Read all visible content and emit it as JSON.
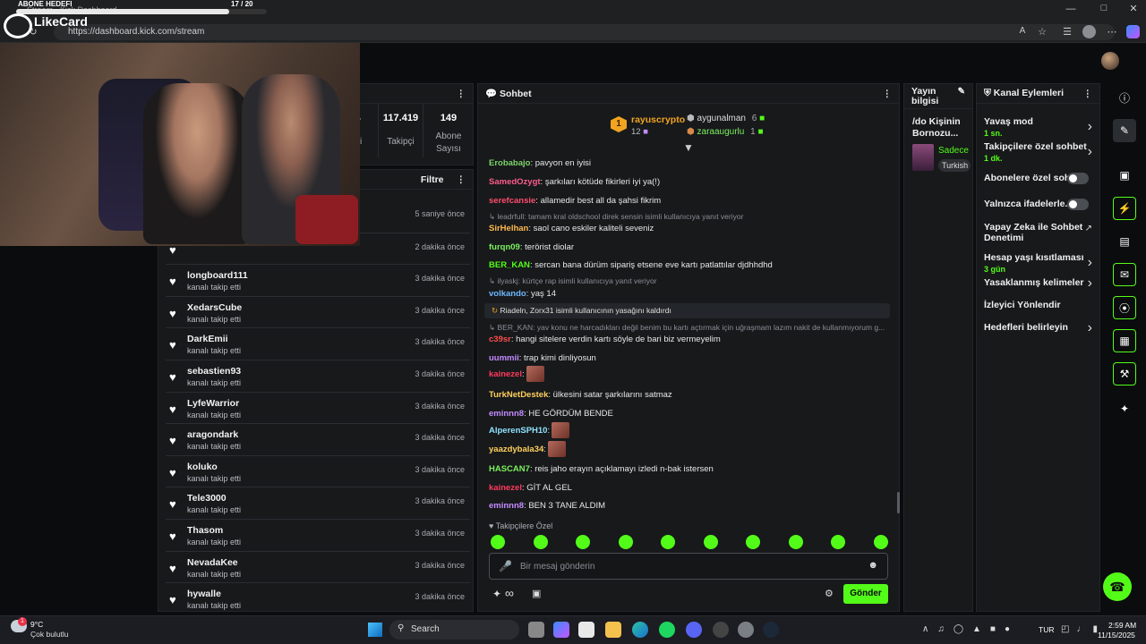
{
  "browser": {
    "overlay_goal_label": "ABONE HEDEFI",
    "overlay_goal_count": "17 / 20",
    "overlay_goal_fraction": 0.85,
    "overlay_brand": "LikeCard",
    "tab_title": "Stream - Kick Dashboard",
    "url": "https://dashboard.kick.com/stream"
  },
  "stats": {
    "partial_value": "4",
    "partial_label": "ici",
    "followers_value": "117.419",
    "followers_label": "Takipçi",
    "subs_value": "149",
    "subs_label_1": "Abone",
    "subs_label_2": "Sayısı"
  },
  "activity": {
    "filter_label": "Filtre",
    "rows": [
      {
        "name": "",
        "sub": "",
        "time": "5 saniye önce"
      },
      {
        "name": "",
        "sub": "",
        "time": "2 dakika önce"
      },
      {
        "name": "longboard111",
        "sub": "kanalı takip etti",
        "time": "3 dakika önce"
      },
      {
        "name": "XedarsCube",
        "sub": "kanalı takip etti",
        "time": "3 dakika önce"
      },
      {
        "name": "DarkEmii",
        "sub": "kanalı takip etti",
        "time": "3 dakika önce"
      },
      {
        "name": "sebastien93",
        "sub": "kanalı takip etti",
        "time": "3 dakika önce"
      },
      {
        "name": "LyfeWarrior",
        "sub": "kanalı takip etti",
        "time": "3 dakika önce"
      },
      {
        "name": "aragondark",
        "sub": "kanalı takip etti",
        "time": "3 dakika önce"
      },
      {
        "name": "koluko",
        "sub": "kanalı takip etti",
        "time": "3 dakika önce"
      },
      {
        "name": "Tele3000",
        "sub": "kanalı takip etti",
        "time": "3 dakika önce"
      },
      {
        "name": "Thasom",
        "sub": "kanalı takip etti",
        "time": "3 dakika önce"
      },
      {
        "name": "NevadaKee",
        "sub": "kanalı takip etti",
        "time": "3 dakika önce"
      },
      {
        "name": "hywalle",
        "sub": "kanalı takip etti",
        "time": "3 dakika önce"
      }
    ]
  },
  "chat": {
    "title": "Sohbet",
    "leader_rank": "1",
    "leader_name": "rayuscrypto",
    "leader_count": "12",
    "top2_name": "aygunalman",
    "top2_count": "6",
    "top3_name": "zaraaugurlu",
    "top3_count": "1",
    "messages": [
      {
        "type": "msg",
        "user": "Erobabajo",
        "color": "#7fd46a",
        "text": ": pavyon en iyisi"
      },
      {
        "type": "msg",
        "user": "SamedOzygt",
        "color": "#ff5c8a",
        "text": ": şarkıları kötüde fikirleri iyi ya(!)"
      },
      {
        "type": "msg",
        "user": "serefcansie",
        "color": "#ff4d6d",
        "text": ": allamedir best all da şahsi fikrim"
      },
      {
        "type": "reply",
        "text": "↳ leadrfull: tamam kral oldschool direk sensin isimli kullanıcıya yanıt veriyor"
      },
      {
        "type": "msg",
        "user": "SirHelhan",
        "color": "#ffb84d",
        "text": ": saol cano eskiler kaliteli seveniz"
      },
      {
        "type": "msg",
        "user": "furqn09",
        "color": "#7cf05c",
        "text": ": terörist diolar"
      },
      {
        "type": "msg",
        "user": "BER_KAN",
        "color": "#53fc18",
        "text": ": sercan bana dürüm sipariş etsene eve kartı patlattılar djdhhdhd"
      },
      {
        "type": "reply",
        "text": "↳ ilyaskj: kürtçe rap isimli kullanıcıya yanıt veriyor"
      },
      {
        "type": "msg",
        "user": "volkando",
        "color": "#6fb8ff",
        "text": ": yaş 14"
      },
      {
        "type": "system",
        "text": "Riadeln, Zorx31 isimli kullanıcının yasağını kaldırdı"
      },
      {
        "type": "reply",
        "text": "↳ BER_KAN: yav konu ne harcadıkları değil benim bu kartı açtırmak için uğraşmam lazım nakit de kullanmıyorum g..."
      },
      {
        "type": "msg",
        "user": "c39sr",
        "color": "#ff4d4d",
        "text": ": hangi sitelere verdin kartı söyle de bari biz vermeyelim"
      },
      {
        "type": "msg",
        "user": "uummii",
        "color": "#c58bff",
        "text": ": trap kimi dinliyosun"
      },
      {
        "type": "msg",
        "user": "kainezel",
        "color": "#ff3b5c",
        "text": ":",
        "emote": true
      },
      {
        "type": "msg",
        "user": "TurkNetDestek",
        "color": "#ffcf5c",
        "text": ": ülkesini satar şarkılarını satmaz"
      },
      {
        "type": "msg",
        "user": "eminnn8",
        "color": "#c58bff",
        "text": ": HE GÖRDÜM BENDE"
      },
      {
        "type": "msg",
        "user": "AlperenSPH10",
        "color": "#8fe3ff",
        "text": ":",
        "emote": true
      },
      {
        "type": "msg",
        "user": "yaazdybala34",
        "color": "#ffd15c",
        "text": ":",
        "emote": true
      },
      {
        "type": "msg",
        "user": "HASCAN7",
        "color": "#7cf05c",
        "text": ": reis jaho erayın açıklamayı izledi n-bak istersen"
      },
      {
        "type": "msg",
        "user": "kainezel",
        "color": "#ff3b5c",
        "text": ": GİT AL GEL"
      },
      {
        "type": "msg",
        "user": "eminnn8",
        "color": "#c58bff",
        "text": ": BEN 3 TANE ALDIM"
      }
    ],
    "followers_only": "Takipçilere Özel",
    "input_placeholder": "Bir mesaj gönderin",
    "infinity": "∞",
    "send_label": "Gönder"
  },
  "stream_info": {
    "title_line1": "Yayın",
    "title_line2": "bilgisi",
    "stream_title_1": "/do Kişinin",
    "stream_title_2": "Bornozu...",
    "category": "Sadece",
    "tag": "Turkish"
  },
  "channel_actions": {
    "title": "Kanal Eylemleri",
    "items": [
      {
        "label": "Yavaş mod",
        "sub": "1 sn.",
        "kind": "chevron"
      },
      {
        "label": "Takipçilere özel sohbet",
        "sub": "1 dk.",
        "kind": "chevron"
      },
      {
        "label": "Abonelere özel sohbet",
        "sub": "",
        "kind": "toggle"
      },
      {
        "label": "Yalnızca ifadelerle...",
        "sub": "",
        "kind": "toggle"
      },
      {
        "label": "Yapay Zeka ile Sohbet Denetimi",
        "sub": "",
        "kind": "external"
      },
      {
        "label": "Hesap yaşı kısıtlaması",
        "sub": "3 gün",
        "kind": "chevron"
      },
      {
        "label": "Yasaklanmış kelimeler",
        "sub": "",
        "kind": "chevron"
      },
      {
        "label": "İzleyici Yönlendir",
        "sub": "",
        "kind": "none"
      },
      {
        "label": "Hedefleri belirleyin",
        "sub": "",
        "kind": "chevron"
      }
    ]
  },
  "taskbar": {
    "weather_temp": "9°C",
    "weather_desc": "Çok bulutlu",
    "search_label": "Search",
    "lang": "TUR",
    "time": "2:59 AM",
    "date": "11/15/2025",
    "badge_count": "1"
  },
  "colors": {
    "accent": "#53fc18",
    "bg": "#0b0c0d",
    "panel": "#17191b"
  }
}
